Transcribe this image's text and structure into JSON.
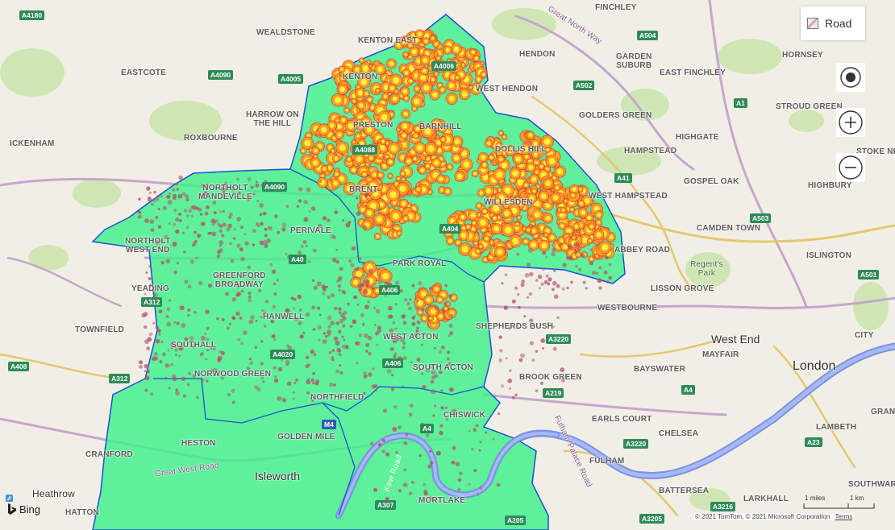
{
  "map": {
    "style_button": {
      "label": "Road",
      "icon": "road-style-icon"
    },
    "controls": {
      "locate_icon": "locate-me-icon",
      "zoom_in_icon": "zoom-in-icon",
      "zoom_out_icon": "zoom-out-icon"
    },
    "attribution": {
      "brand": "Bing",
      "copyright": "© 2021 TomTom, © 2021 Microsoft Corporation",
      "terms": "Terms"
    },
    "scale": {
      "miles": "1 miles",
      "km": "1 km"
    },
    "colors": {
      "overlay_fill": "#3ef08a",
      "overlay_border": "#1d4fd8",
      "heat_hot": "#ffee3a",
      "heat_mid": "#ff9a1f",
      "heat_low": "#d0433c",
      "dots": "#b0506a",
      "river": "#7b93e6"
    },
    "place_labels": {
      "wealdstone": "WEALDSTONE",
      "kenton_east": "KENTON EAST",
      "finchley": "FINCHLEY",
      "hendon": "HENDON",
      "garden_suburb": "GARDEN\nSUBURB",
      "east_finchley": "EAST FINCHLEY",
      "hornsey": "HORNSEY",
      "eastcote": "EASTCOTE",
      "kenton": "KENTON",
      "west_hendon": "WEST HENDON",
      "stroud_green": "STROUD GREEN",
      "harrow": "HARROW ON\nTHE HILL",
      "golders_green": "GOLDERS GREEN",
      "roxbourne": "ROXBOURNE",
      "preston": "PRESTON",
      "barnhill": "BARNHILL",
      "dollis_hill": "DOLLIS HILL",
      "hampstead": "HAMPSTEAD",
      "highgate": "HIGHGATE",
      "ickenham": "ICKENHAM",
      "stoke": "STOKE NE",
      "northolt_mandeville": "NORTHOLT\nMANDEVILLE",
      "brent": "BRENT",
      "gospel_oak": "GOSPEL OAK",
      "west_hampstead": "WEST HAMPSTEAD",
      "highbury": "HIGHBURY",
      "willesden": "WILLESDEN",
      "perivale": "PERIVALE",
      "camden_town": "CAMDEN TOWN",
      "northolt_west_end": "NORTHOLT\nWEST END",
      "abbey_road": "ABBEY ROAD",
      "islington": "ISLINGTON",
      "park_royal": "PARK ROYAL",
      "regents_park": "Regent's\nPark",
      "greenford": "GREENFORD\nBROADWAY",
      "lisson_grove": "LISSON GROVE",
      "yeading": "YEADING",
      "westbourne": "WESTBOURNE",
      "hanwell": "HANWELL",
      "shepherds_bush": "SHEPHERDS BUSH",
      "townfield": "TOWNFIELD",
      "west_acton": "WEST ACTON",
      "city": "CITY",
      "west_end": "West End",
      "southall": "SOUTHALL",
      "mayfair": "MAYFAIR",
      "london": "London",
      "norwood_green": "NORWOOD GREEN",
      "south_acton": "SOUTH ACTON",
      "bayswater": "BAYSWATER",
      "brook_green": "BROOK GREEN",
      "northfield": "NORTHFIELD",
      "chiswick": "CHISWICK",
      "earls_court": "EARLS COURT",
      "lambeth": "LAMBETH",
      "heston": "HESTON",
      "golden_mile": "GOLDEN MILE",
      "chelsea": "CHELSEA",
      "cranford": "CRANFORD",
      "fulham": "FULHAM",
      "isleworth": "Isleworth",
      "heathrow": "Heathrow",
      "battersea": "BATTERSEA",
      "larkhall": "LARKHALL",
      "southwark": "SOUTHWARK",
      "mortlake": "MORTLAKE",
      "hatton": "HATTON",
      "gran": "GRAN",
      "great_west_road": "Great West Road",
      "great_north_way": "Great North Way",
      "kew_road": "Kew Road",
      "fulham_palace_road": "Fulham Palace Road"
    },
    "road_shields": {
      "a4180": "A4180",
      "a504": "A504",
      "a4006": "A4006",
      "a4090_top": "A4090",
      "a4005": "A4005",
      "a502": "A502",
      "a1": "A1",
      "a4088": "A4088",
      "a41": "A41",
      "a4090_mid": "A4090",
      "a503": "A503",
      "a404": "A404",
      "a40": "A40",
      "a406_top": "A406",
      "a501": "A501",
      "a312_top": "A312",
      "a3220_top": "A3220",
      "a4020": "A4020",
      "a406_bot": "A406",
      "a408": "A408",
      "a312_bot": "A312",
      "a219": "A219",
      "a4_east": "A4",
      "m4": "M4",
      "a4_west": "A4",
      "a3220_bot": "A3220",
      "a23": "A23",
      "a3216": "A3216",
      "a307": "A307",
      "a205": "A205",
      "a3205": "A3205"
    }
  }
}
